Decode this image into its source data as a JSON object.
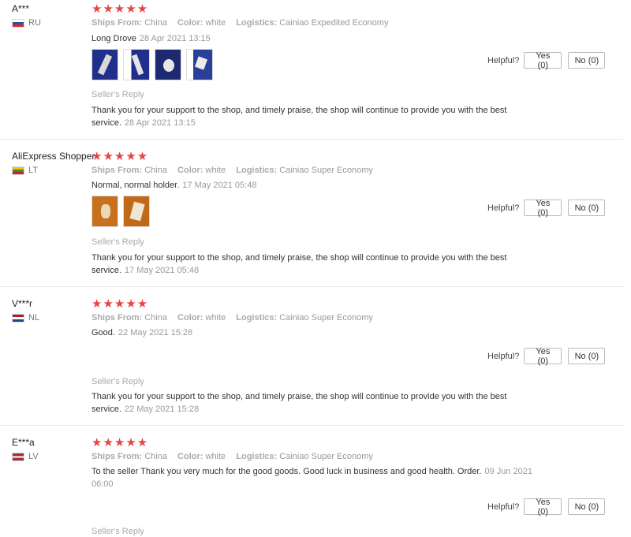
{
  "labels": {
    "ships_from": "Ships From:",
    "color": "Color:",
    "logistics": "Logistics:",
    "helpful": "Helpful?",
    "sellers_reply": "Seller's Reply",
    "stars": "★★★★★"
  },
  "reviews": [
    {
      "user": "A***",
      "country": "RU",
      "flag_colors": [
        "#ffffff",
        "#2b4fa8",
        "#d52b1e"
      ],
      "rating": 5,
      "ships_from": "China",
      "color": "white",
      "logistics": "Cainiao Expedited Economy",
      "feedback": "Long Drove",
      "feedback_date": "28 Apr 2021 13:15",
      "photo_count": 4,
      "yes": "Yes (0)",
      "no": "No (0)",
      "reply": "Thank you for your support to the shop, and timely praise, the shop will continue to provide you with the best service.",
      "reply_date": "28 Apr 2021 13:15"
    },
    {
      "user": "AliExpress Shopper",
      "country": "LT",
      "flag_colors": [
        "#f4c300",
        "#3a8a3a",
        "#c1272d"
      ],
      "rating": 5,
      "ships_from": "China",
      "color": "white",
      "logistics": "Cainiao Super Economy",
      "feedback": "Normal, normal holder.",
      "feedback_date": "17 May 2021 05:48",
      "photo_count": 2,
      "yes": "Yes (0)",
      "no": "No (0)",
      "reply": "Thank you for your support to the shop, and timely praise, the shop will continue to provide you with the best service.",
      "reply_date": "17 May 2021 05:48"
    },
    {
      "user": "V***r",
      "country": "NL",
      "flag_colors": [
        "#ae1c28",
        "#ffffff",
        "#21468b"
      ],
      "rating": 5,
      "ships_from": "China",
      "color": "white",
      "logistics": "Cainiao Super Economy",
      "feedback": "Good.",
      "feedback_date": "22 May 2021 15:28",
      "photo_count": 0,
      "yes": "Yes (0)",
      "no": "No (0)",
      "reply": "Thank you for your support to the shop, and timely praise, the shop will continue to provide you with the best service.",
      "reply_date": "22 May 2021 15:28"
    },
    {
      "user": "E***a",
      "country": "LV",
      "flag_colors": [
        "#9e3039",
        "#ffffff",
        "#9e3039"
      ],
      "rating": 5,
      "ships_from": "China",
      "color": "white",
      "logistics": "Cainiao Super Economy",
      "feedback": "To the seller Thank you very much for the good goods. Good luck in business and good health. Order.",
      "feedback_date": "09 Jun 2021 06:00",
      "photo_count": 0,
      "yes": "Yes (0)",
      "no": "No (0)",
      "reply": "",
      "reply_date": ""
    }
  ]
}
